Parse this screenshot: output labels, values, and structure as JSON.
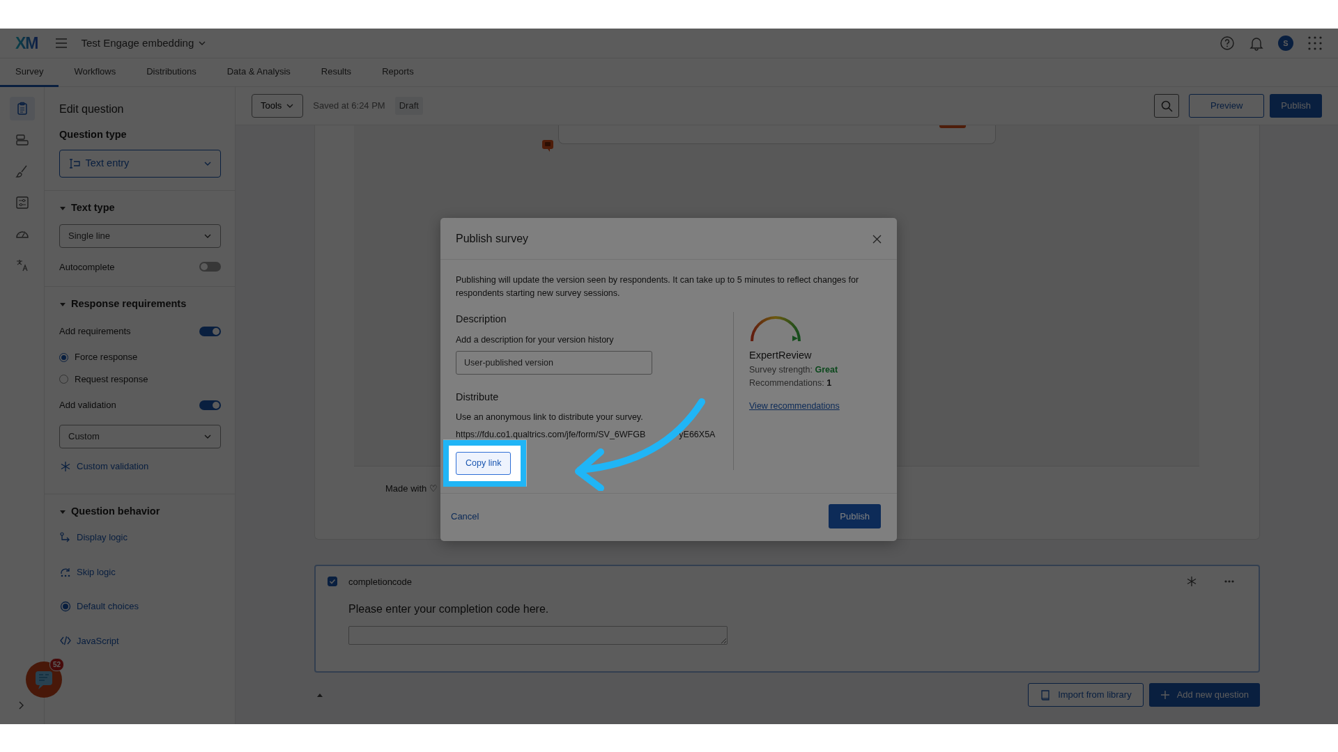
{
  "app": {
    "logo": "XM",
    "project": "Test Engage embedding",
    "avatar": "S"
  },
  "tabs": [
    {
      "label": "Survey",
      "selected": true
    },
    {
      "label": "Workflows",
      "selected": false
    },
    {
      "label": "Distributions",
      "selected": false
    },
    {
      "label": "Data & Analysis",
      "selected": false
    },
    {
      "label": "Results",
      "selected": false
    },
    {
      "label": "Reports",
      "selected": false
    }
  ],
  "rail": [
    {
      "selected": true
    },
    {
      "selected": false
    },
    {
      "selected": false
    },
    {
      "selected": false
    },
    {
      "selected": false
    },
    {
      "selected": false
    }
  ],
  "toolbar": {
    "tools": "Tools",
    "saved": "Saved at 6:24 PM",
    "status": "Draft",
    "preview": "Preview",
    "publish": "Publish"
  },
  "edit_panel": {
    "title": "Edit question",
    "rows": [
      {
        "kind": "label",
        "text": "Question type"
      },
      {
        "kind": "type-select",
        "value": "Text entry"
      },
      {
        "kind": "section",
        "text": "Text type",
        "expanded": true
      },
      {
        "kind": "select",
        "value": "Single line"
      },
      {
        "kind": "toggle",
        "text": "Autocomplete",
        "on": false
      },
      {
        "kind": "section",
        "text": "Response requirements",
        "expanded": true
      },
      {
        "kind": "toggle",
        "text": "Add requirements",
        "on": true
      },
      {
        "kind": "radio",
        "text": "Force response",
        "selected": true
      },
      {
        "kind": "radio",
        "text": "Request response",
        "selected": false
      },
      {
        "kind": "toggle",
        "text": "Add validation",
        "on": true
      },
      {
        "kind": "select",
        "value": "Custom"
      },
      {
        "kind": "link",
        "text": "Custom validation"
      },
      {
        "kind": "section",
        "text": "Question behavior",
        "expanded": true
      },
      {
        "kind": "link",
        "text": "Display logic"
      },
      {
        "kind": "link",
        "text": "Skip logic"
      },
      {
        "kind": "link",
        "text": "Default choices"
      },
      {
        "kind": "link",
        "text": "JavaScript"
      }
    ]
  },
  "canvas": {
    "made_with": "Made with ♡"
  },
  "question": {
    "checked": true,
    "id": "completioncode",
    "text": "Please enter your completion code here."
  },
  "footer": {
    "import": "Import from library",
    "add": "Add new question"
  },
  "chat_badge": "52",
  "modal": {
    "title": "Publish survey",
    "intro": "Publishing will update the version seen by respondents. It can take up to 5 minutes to reflect changes for respondents starting new survey sessions.",
    "description_heading": "Description",
    "description_hint": "Add a description for your version history",
    "description_value": "User-published version",
    "distribute_heading": "Distribute",
    "distribute_hint": "Use an anonymous link to distribute your survey.",
    "url_parts": [
      "https://fdu.co1.qualtrics.com/jfe/form/SV_6WFGB",
      "yE66X5A"
    ],
    "copy": "Copy link",
    "review_title": "ExpertReview",
    "strength": "Survey strength: **Great**",
    "recommendations": "Recommendations: **1**",
    "view": "View recommendations",
    "cancel": "Cancel",
    "publish": "Publish"
  }
}
